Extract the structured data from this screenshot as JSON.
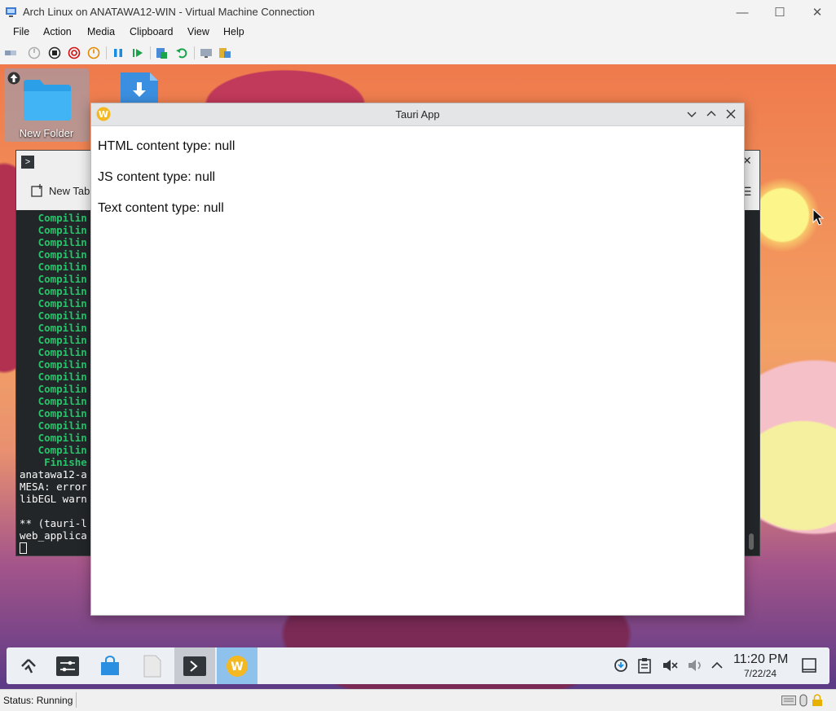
{
  "host": {
    "title": "Arch Linux on ANATAWA12-WIN - Virtual Machine Connection",
    "menu": [
      "File",
      "Action",
      "Media",
      "Clipboard",
      "View",
      "Help"
    ],
    "status": "Status: Running"
  },
  "desktop": {
    "icons": [
      {
        "label": "New Folder",
        "icon": "folder-icon"
      },
      {
        "label": "",
        "icon": "download-file-icon"
      }
    ]
  },
  "terminal": {
    "tab_label": "New Tab",
    "compiling_word": "Compilin",
    "compiling_count": 20,
    "finished_word": "Finishe",
    "lines": [
      "anatawa12-a",
      "MESA: error",
      "libEGL warn",
      "",
      "** (tauri-l",
      "web_applica"
    ]
  },
  "tauri_window": {
    "title": "Tauri App",
    "content": [
      "HTML content type: null",
      "JS content type: null",
      "Text content type: null"
    ]
  },
  "taskbar": {
    "time": "11:20 PM",
    "date": "7/22/24"
  }
}
